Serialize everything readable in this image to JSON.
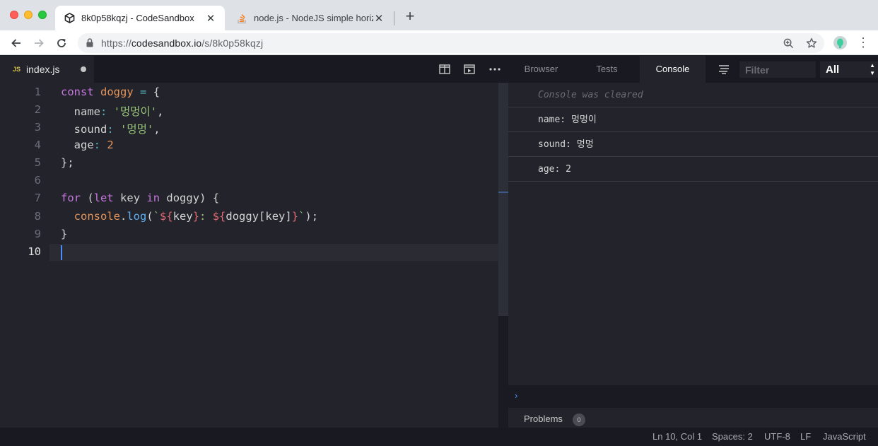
{
  "browser": {
    "tabs": [
      {
        "title": "8k0p58kqzj - CodeSandbox",
        "active": true,
        "favicon": "codesandbox-cube-icon"
      },
      {
        "title": "node.js - NodeJS simple horizo",
        "active": false,
        "favicon": "stackoverflow-icon"
      }
    ],
    "close_glyph": "✕",
    "new_tab_glyph": "+",
    "url_prefix": "https://",
    "url_host": "codesandbox.io",
    "url_path": "/s/8k0p58kqzj"
  },
  "editor": {
    "file_badge": "JS",
    "file_name": "index.js",
    "line_numbers": [
      "1",
      "2",
      "3",
      "4",
      "5",
      "6",
      "7",
      "8",
      "9",
      "10"
    ],
    "active_line": "10"
  },
  "code": {
    "l1_const": "const",
    "l1_name": "doggy",
    "l1_eq": "=",
    "l1_brace": "{",
    "l2_key": "name",
    "l2_colon": ":",
    "l2_val": "'멍멍이'",
    "l2_comma": ",",
    "l3_key": "sound",
    "l3_colon": ":",
    "l3_val": "'멍멍'",
    "l3_comma": ",",
    "l4_key": "age",
    "l4_colon": ":",
    "l4_val": "2",
    "l5": "};",
    "l7_for": "for",
    "l7_open": "(",
    "l7_let": "let",
    "l7_key": "key",
    "l7_in": "in",
    "l7_obj": "doggy",
    "l7_close": ") {",
    "l8_console": "console",
    "l8_dot": ".",
    "l8_log": "log",
    "l8_paren": "(",
    "l8_tick_open": "`",
    "l8_i1_open": "${",
    "l8_i1_var": "key",
    "l8_i1_close": "}",
    "l8_sep": ": ",
    "l8_i2_open": "${",
    "l8_i2_var": "doggy[key]",
    "l8_i2_close": "}",
    "l8_tick_close": "`",
    "l8_end": ");",
    "l9": "}"
  },
  "panel": {
    "tabs": [
      "Browser",
      "Tests",
      "Console"
    ],
    "active_tab": "Console",
    "filter_placeholder": "Filter",
    "level_value": "All"
  },
  "console": {
    "cleared_message": "Console was cleared",
    "logs": [
      "name: 멍멍이",
      "sound: 멍멍",
      "age: 2"
    ],
    "prompt": "›"
  },
  "problems": {
    "label": "Problems",
    "count": "0"
  },
  "status": {
    "position": "Ln 10, Col 1",
    "spaces": "Spaces: 2",
    "encoding": "UTF-8",
    "eol": "LF",
    "language": "JavaScript"
  },
  "colors": {
    "editor_bg": "#22232b",
    "keyword": "#c678dd",
    "variable": "#e5955b",
    "string": "#98c379",
    "function": "#61afef",
    "interpolation": "#e06c75",
    "cursor": "#4c8ef7"
  }
}
